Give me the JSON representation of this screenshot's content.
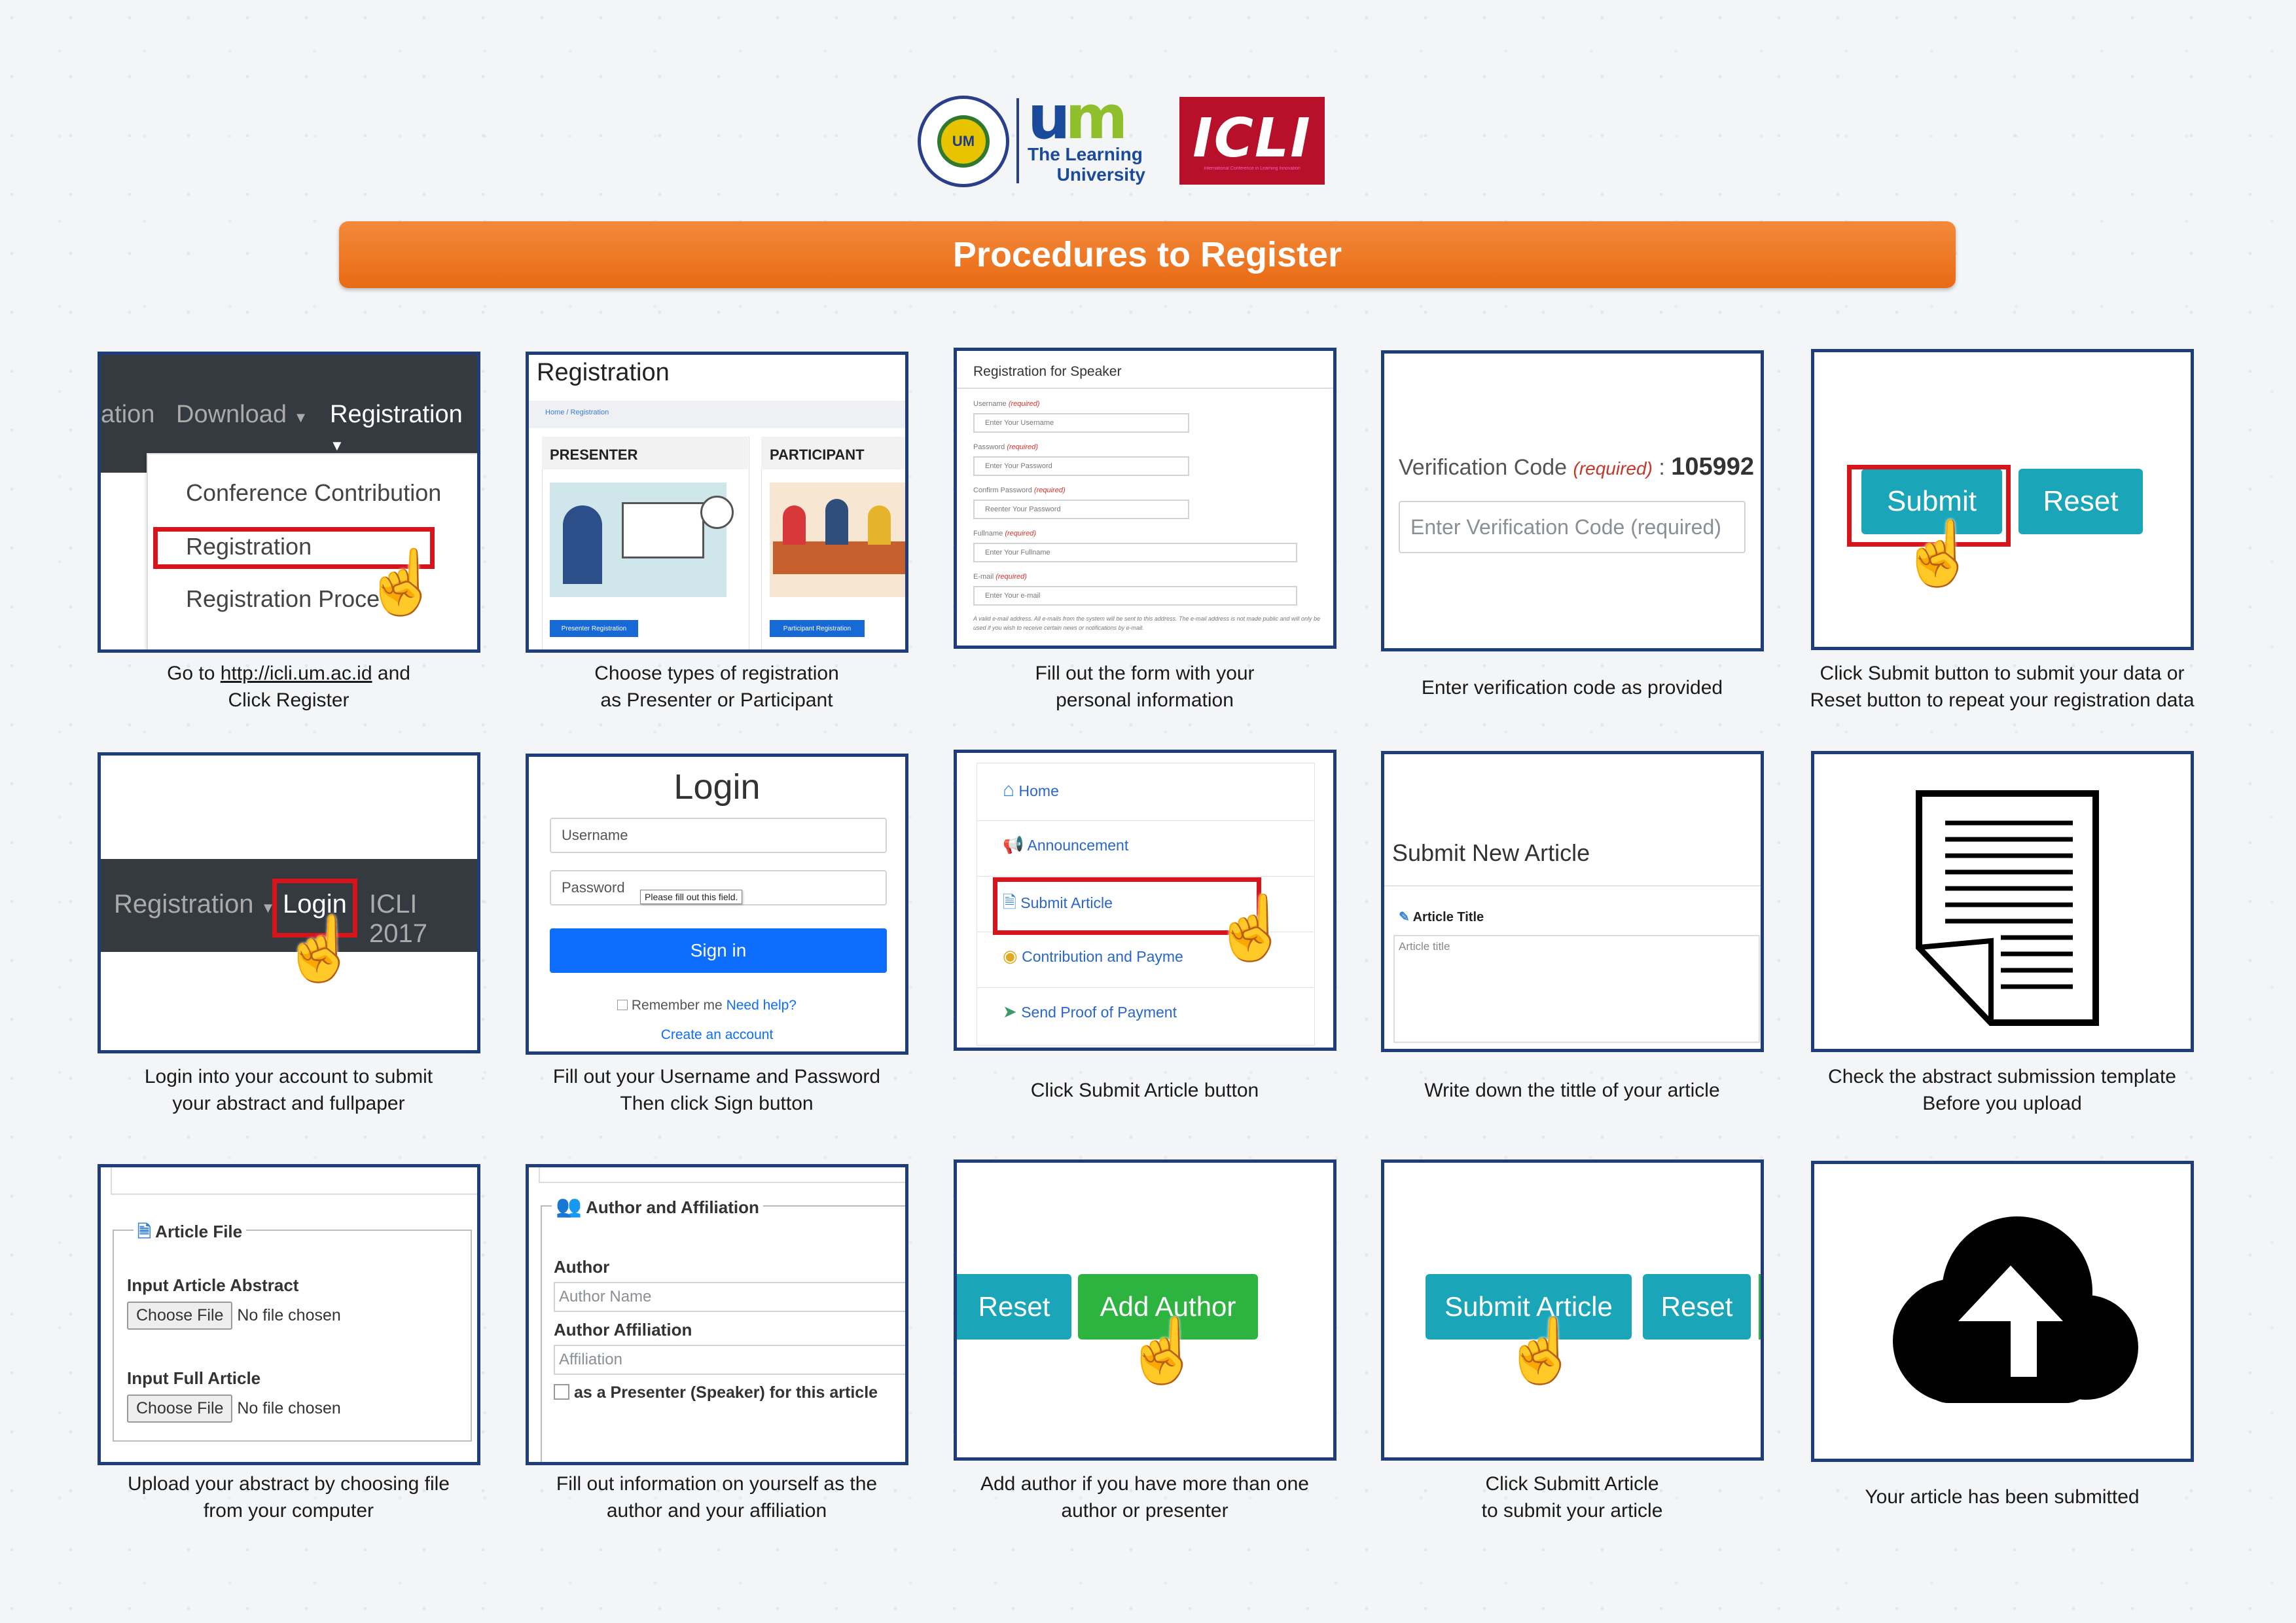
{
  "header": {
    "seal_text": "UM",
    "um_line1": "The Learning",
    "um_line2": "University",
    "icli_word": "ICLI",
    "icli_sub": "International Conference in Learning Innovation",
    "banner_title": "Procedures to Register"
  },
  "colors": {
    "banner": "#ee7723",
    "panel_border": "#1f3d7a",
    "highlight_red": "#d7141a",
    "teal": "#1aa5b8",
    "green": "#2db33f",
    "navy_bar": "#343a40",
    "sign_in_blue": "#0d6efd"
  },
  "steps": [
    {
      "caption_pre": "Go to ",
      "link": "http://icli.um.ac.id",
      "caption_post": " and",
      "caption_line2": "Click Register",
      "nav": {
        "partial": "ation",
        "download": "Download",
        "registration": "Registration"
      },
      "menu": [
        "Conference Contribution",
        "Registration",
        "Registration Proce"
      ]
    },
    {
      "caption_line1": "Choose types of registration",
      "caption_line2": "as Presenter or Participant",
      "title": "Registration",
      "breadcrumb": "Home / Registration",
      "presenter": "PRESENTER",
      "participant": "PARTICIPANT",
      "presenter_btn": "Presenter Registration",
      "participant_btn": "Participant Registration"
    },
    {
      "caption_line1": "Fill out the form with your",
      "caption_line2": "personal information",
      "title": "Registration for Speaker",
      "fields": [
        {
          "label": "Username",
          "req": "(required)",
          "placeholder": "Enter Your Username"
        },
        {
          "label": "Password",
          "req": "(required)",
          "placeholder": "Enter Your Password"
        },
        {
          "label": "Confirm Password",
          "req": "(required)",
          "placeholder": "Reenter Your Password"
        },
        {
          "label": "Fullname",
          "req": "(required)",
          "placeholder": "Enter Your Fullname"
        },
        {
          "label": "E-mail",
          "req": "(required)",
          "placeholder": "Enter Your e-mail"
        }
      ],
      "note": "A valid e-mail address. All e-mails from the system will be sent to this address. The e-mail address is not made public and will only be used if you wish to receive certain news or notifications by e-mail."
    },
    {
      "caption_line1": "Enter verification code as provided",
      "label": "Verification Code",
      "req": "(required)",
      "code": "105992",
      "placeholder": "Enter Verification Code (required)"
    },
    {
      "caption_line1": "Click Submit button to submit your data or",
      "caption_line2": "Reset button to repeat your registration data",
      "submit": "Submit",
      "reset": "Reset"
    },
    {
      "caption_line1": "Login into your account to submit",
      "caption_line2": "your abstract and fullpaper",
      "nav": {
        "registration": "Registration",
        "login": "Login",
        "icli": "ICLI 2017"
      }
    },
    {
      "caption_line1": "Fill out your Username and Password",
      "caption_line2": "Then click Sign button",
      "title": "Login",
      "username": "Username",
      "password": "Password",
      "tooltip": "Please fill out this field.",
      "signin": "Sign in",
      "remember": "Remember me",
      "help": "Need help?",
      "create": "Create an account"
    },
    {
      "caption_line1": "Click Submit Article button",
      "menu": [
        {
          "icon": "home-icon",
          "label": "Home"
        },
        {
          "icon": "megaphone-icon",
          "label": "Announcement"
        },
        {
          "icon": "document-icon",
          "label": "Submit Article"
        },
        {
          "icon": "coins-icon",
          "label": "Contribution and Payme"
        },
        {
          "icon": "send-icon",
          "label": "Send Proof of Payment"
        }
      ]
    },
    {
      "caption_line1": "Write down the tittle of your article",
      "title": "Submit New Article",
      "field_label": "Article Title",
      "placeholder": "Article title"
    },
    {
      "caption_line1": "Check the abstract submission template",
      "caption_line2": "Before you upload"
    },
    {
      "caption_line1": "Upload your abstract by choosing file",
      "caption_line2": "from your computer",
      "legend": "Article File",
      "abstract_label": "Input Article Abstract",
      "full_label": "Input Full Article",
      "choose": "Choose File",
      "no_file": "No file chosen"
    },
    {
      "caption_line1": "Fill out information on yourself as the",
      "caption_line2": "author and your affiliation",
      "legend": "Author and Affiliation",
      "author_label": "Author",
      "author_placeholder": "Author Name",
      "aff_label": "Author Affiliation",
      "aff_placeholder": "Affiliation",
      "presenter_check": "as a Presenter (Speaker) for this article"
    },
    {
      "caption_line1": "Add author if you have more than one",
      "caption_line2": "author or presenter",
      "reset": "Reset",
      "add": "Add Author"
    },
    {
      "caption_line1": "Click Submitt Article",
      "caption_line2": "to submit your article",
      "submit": "Submit Article",
      "reset": "Reset"
    },
    {
      "caption_line1": "Your article has been submitted"
    }
  ]
}
